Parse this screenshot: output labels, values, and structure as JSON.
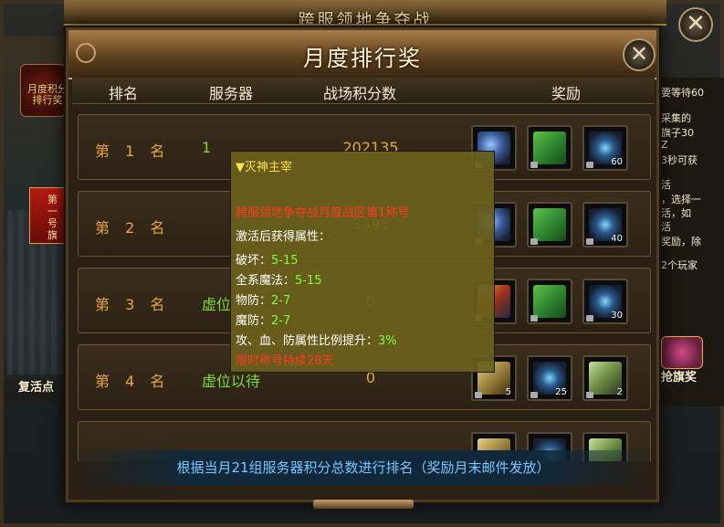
{
  "background": {
    "outer_title": "跨服领地争夺战",
    "left_badge": "月度积分排行奖",
    "left_banner": "第一号旗",
    "revive_label": "复活点",
    "right_panel_lines": [
      "要等待60",
      "采集的",
      "旗子30",
      "Z",
      "3秒可获",
      "活",
      "，选择一",
      "活，如",
      "活",
      "奖励，除",
      "2个玩家"
    ],
    "grab_label": "抢旗奖",
    "close_symbol": "✕"
  },
  "dialog": {
    "title": "月度排行奖",
    "close_symbol": "✕",
    "headers": {
      "rank": "排名",
      "server": "服务器",
      "score": "战场积分数",
      "reward": "奖励"
    },
    "rows": [
      {
        "rank": "第 1 名",
        "server": "1",
        "score": "202135",
        "rewards": [
          {
            "icon": "wing-icon",
            "qty": ""
          },
          {
            "icon": "green-book-icon",
            "qty": ""
          },
          {
            "icon": "gem-icon",
            "qty": "60"
          }
        ]
      },
      {
        "rank": "第 2 名",
        "server": "",
        "score": "3395",
        "rewards": [
          {
            "icon": "wing-icon",
            "qty": ""
          },
          {
            "icon": "green-book-icon",
            "qty": ""
          },
          {
            "icon": "gem-icon",
            "qty": "40"
          }
        ]
      },
      {
        "rank": "第 3 名",
        "server": "虚位",
        "score": "0",
        "rewards": [
          {
            "icon": "blade-icon",
            "qty": ""
          },
          {
            "icon": "green-book-icon",
            "qty": ""
          },
          {
            "icon": "gem-icon",
            "qty": "30"
          }
        ]
      },
      {
        "rank": "第 4 名",
        "server": "虚位以待",
        "score": "0",
        "rewards": [
          {
            "icon": "gold-book-icon",
            "qty": "5"
          },
          {
            "icon": "gem-icon",
            "qty": "25"
          },
          {
            "icon": "scroll-icon",
            "qty": "2"
          }
        ]
      },
      {
        "rank": "",
        "server": "",
        "score": "",
        "rewards": [
          {
            "icon": "gold-book-icon",
            "qty": ""
          },
          {
            "icon": "gem-icon",
            "qty": ""
          },
          {
            "icon": "scroll-icon",
            "qty": ""
          }
        ]
      }
    ],
    "footer": "根据当月21组服务器积分总数进行排名（奖励月末邮件发放）"
  },
  "tooltip": {
    "title": "▼灭神主宰",
    "desc": "跨服领地争夺战月度战区第1称号",
    "activate_label": "激活后获得属性：",
    "attrs": [
      {
        "label": "破坏：",
        "value": "5-15"
      },
      {
        "label": "全系魔法：",
        "value": "5-15"
      },
      {
        "label": "物防：",
        "value": "2-7"
      },
      {
        "label": "魔防：",
        "value": "2-7"
      },
      {
        "label": "攻、血、防属性比例提升：",
        "value": "3%"
      }
    ],
    "duration": "限时称号持续28天"
  },
  "colors": {
    "rank": "#e9a640",
    "server": "#7edc3a",
    "footer": "#7cc4ff",
    "tooltip_title": "#ffe34d",
    "tooltip_red": "#ff3b24",
    "tooltip_green": "#7cff3c"
  }
}
